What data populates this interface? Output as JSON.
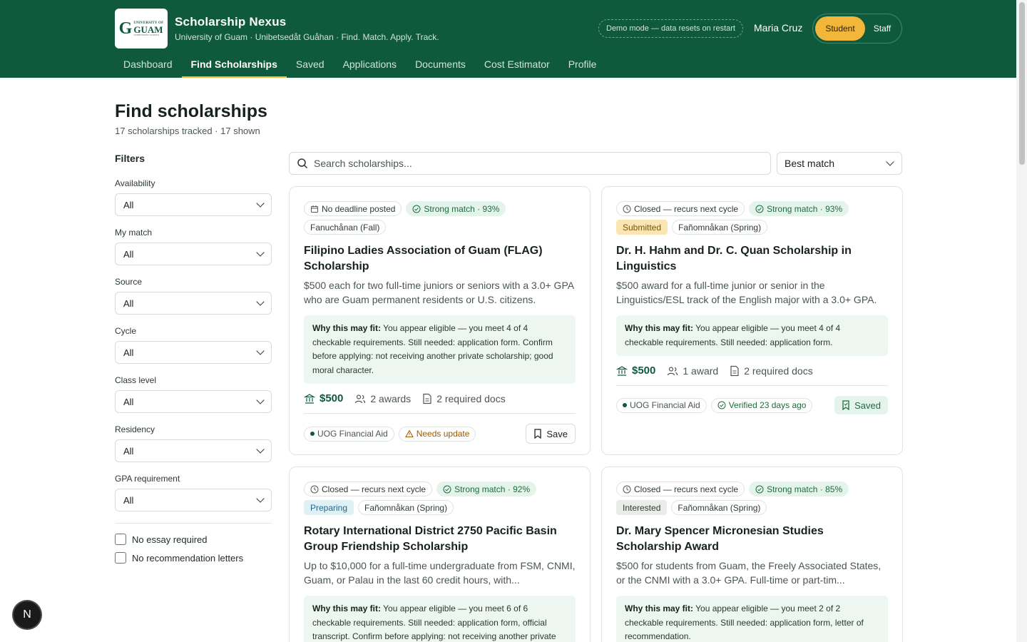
{
  "app": {
    "logo": {
      "line1": "UNIVERSITY OF",
      "big": "GUAM",
      "line3": "UNIBETSEDÅT GUÅHAN"
    },
    "title": "Scholarship Nexus",
    "subtitle": "University of Guam · Unibetsedåt Guåhan · Find. Match. Apply. Track.",
    "demo_badge": "Demo mode — data resets on restart",
    "user_name": "Maria Cruz",
    "roles": [
      "Student",
      "Staff"
    ]
  },
  "nav": {
    "items": [
      "Dashboard",
      "Find Scholarships",
      "Saved",
      "Applications",
      "Documents",
      "Cost Estimator",
      "Profile"
    ],
    "active": "Find Scholarships"
  },
  "page": {
    "title": "Find scholarships",
    "count": "17 scholarships tracked · 17 shown"
  },
  "filters": {
    "title": "Filters",
    "groups": [
      {
        "label": "Availability",
        "value": "All"
      },
      {
        "label": "My match",
        "value": "All"
      },
      {
        "label": "Source",
        "value": "All"
      },
      {
        "label": "Cycle",
        "value": "All"
      },
      {
        "label": "Class level",
        "value": "All"
      },
      {
        "label": "Residency",
        "value": "All"
      },
      {
        "label": "GPA requirement",
        "value": "All"
      }
    ],
    "checks": [
      "No essay required",
      "No recommendation letters"
    ]
  },
  "search": {
    "placeholder": "Search scholarships..."
  },
  "sort": {
    "value": "Best match"
  },
  "colors": {
    "brand": "#0f5a3d",
    "accent": "#f2b63a",
    "match_bg": "#e5f4ea"
  },
  "cards": [
    {
      "deadline": "No deadline posted",
      "match": "Strong match · 93%",
      "status": "",
      "cycle": "Fanuchånan (Fall)",
      "title": "Filipino Ladies Association of Guam (FLAG) Scholarship",
      "desc": "$500 each for two full-time juniors or seniors with a 3.0+ GPA who are Guam permanent residents or U.S. citizens.",
      "why_label": "Why this may fit:",
      "why": "You appear eligible — you meet 4 of 4 checkable requirements. Still needed: application form. Confirm before applying: not receiving another private scholarship; good moral character.",
      "amount": "$500",
      "awards": "2 awards",
      "docs": "2 required docs",
      "source": "UOG Financial Aid",
      "freshness": "Needs update",
      "action": "Save"
    },
    {
      "deadline": "Closed — recurs next cycle",
      "match": "Strong match · 93%",
      "status": "Submitted",
      "cycle": "Fañomnåkan (Spring)",
      "title": "Dr. H. Hahm and Dr. C. Quan Scholarship in Linguistics",
      "desc": "$500 award for a full-time junior or senior in the Linguistics/ESL track of the English major with a 3.0+ GPA.",
      "why_label": "Why this may fit:",
      "why": "You appear eligible — you meet 4 of 4 checkable requirements. Still needed: application form.",
      "amount": "$500",
      "awards": "1 award",
      "docs": "2 required docs",
      "source": "UOG Financial Aid",
      "freshness": "Verified 23 days ago",
      "action": "Saved"
    },
    {
      "deadline": "Closed — recurs next cycle",
      "match": "Strong match · 92%",
      "status": "Preparing",
      "cycle": "Fañomnåkan (Spring)",
      "title": "Rotary International District 2750 Pacific Basin Group Friendship Scholarship",
      "desc": "Up to $10,000 for a full-time undergraduate from FSM, CNMI, Guam, or Palau in the last 60 credit hours, with...",
      "why_label": "Why this may fit:",
      "why": "You appear eligible — you meet 6 of 6 checkable requirements. Still needed: application form, official transcript. Confirm before applying: not receiving another private"
    },
    {
      "deadline": "Closed — recurs next cycle",
      "match": "Strong match · 85%",
      "status": "Interested",
      "cycle": "Fañomnåkan (Spring)",
      "title": "Dr. Mary Spencer Micronesian Studies Scholarship Award",
      "desc": "$500 for students from Guam, the Freely Associated States, or the CNMI with a 3.0+ GPA. Full-time or part-tim...",
      "why_label": "Why this may fit:",
      "why": "You appear eligible — you meet 2 of 2 checkable requirements. Still needed: application form, letter of recommendation."
    }
  ],
  "fab": {
    "label": "N"
  }
}
